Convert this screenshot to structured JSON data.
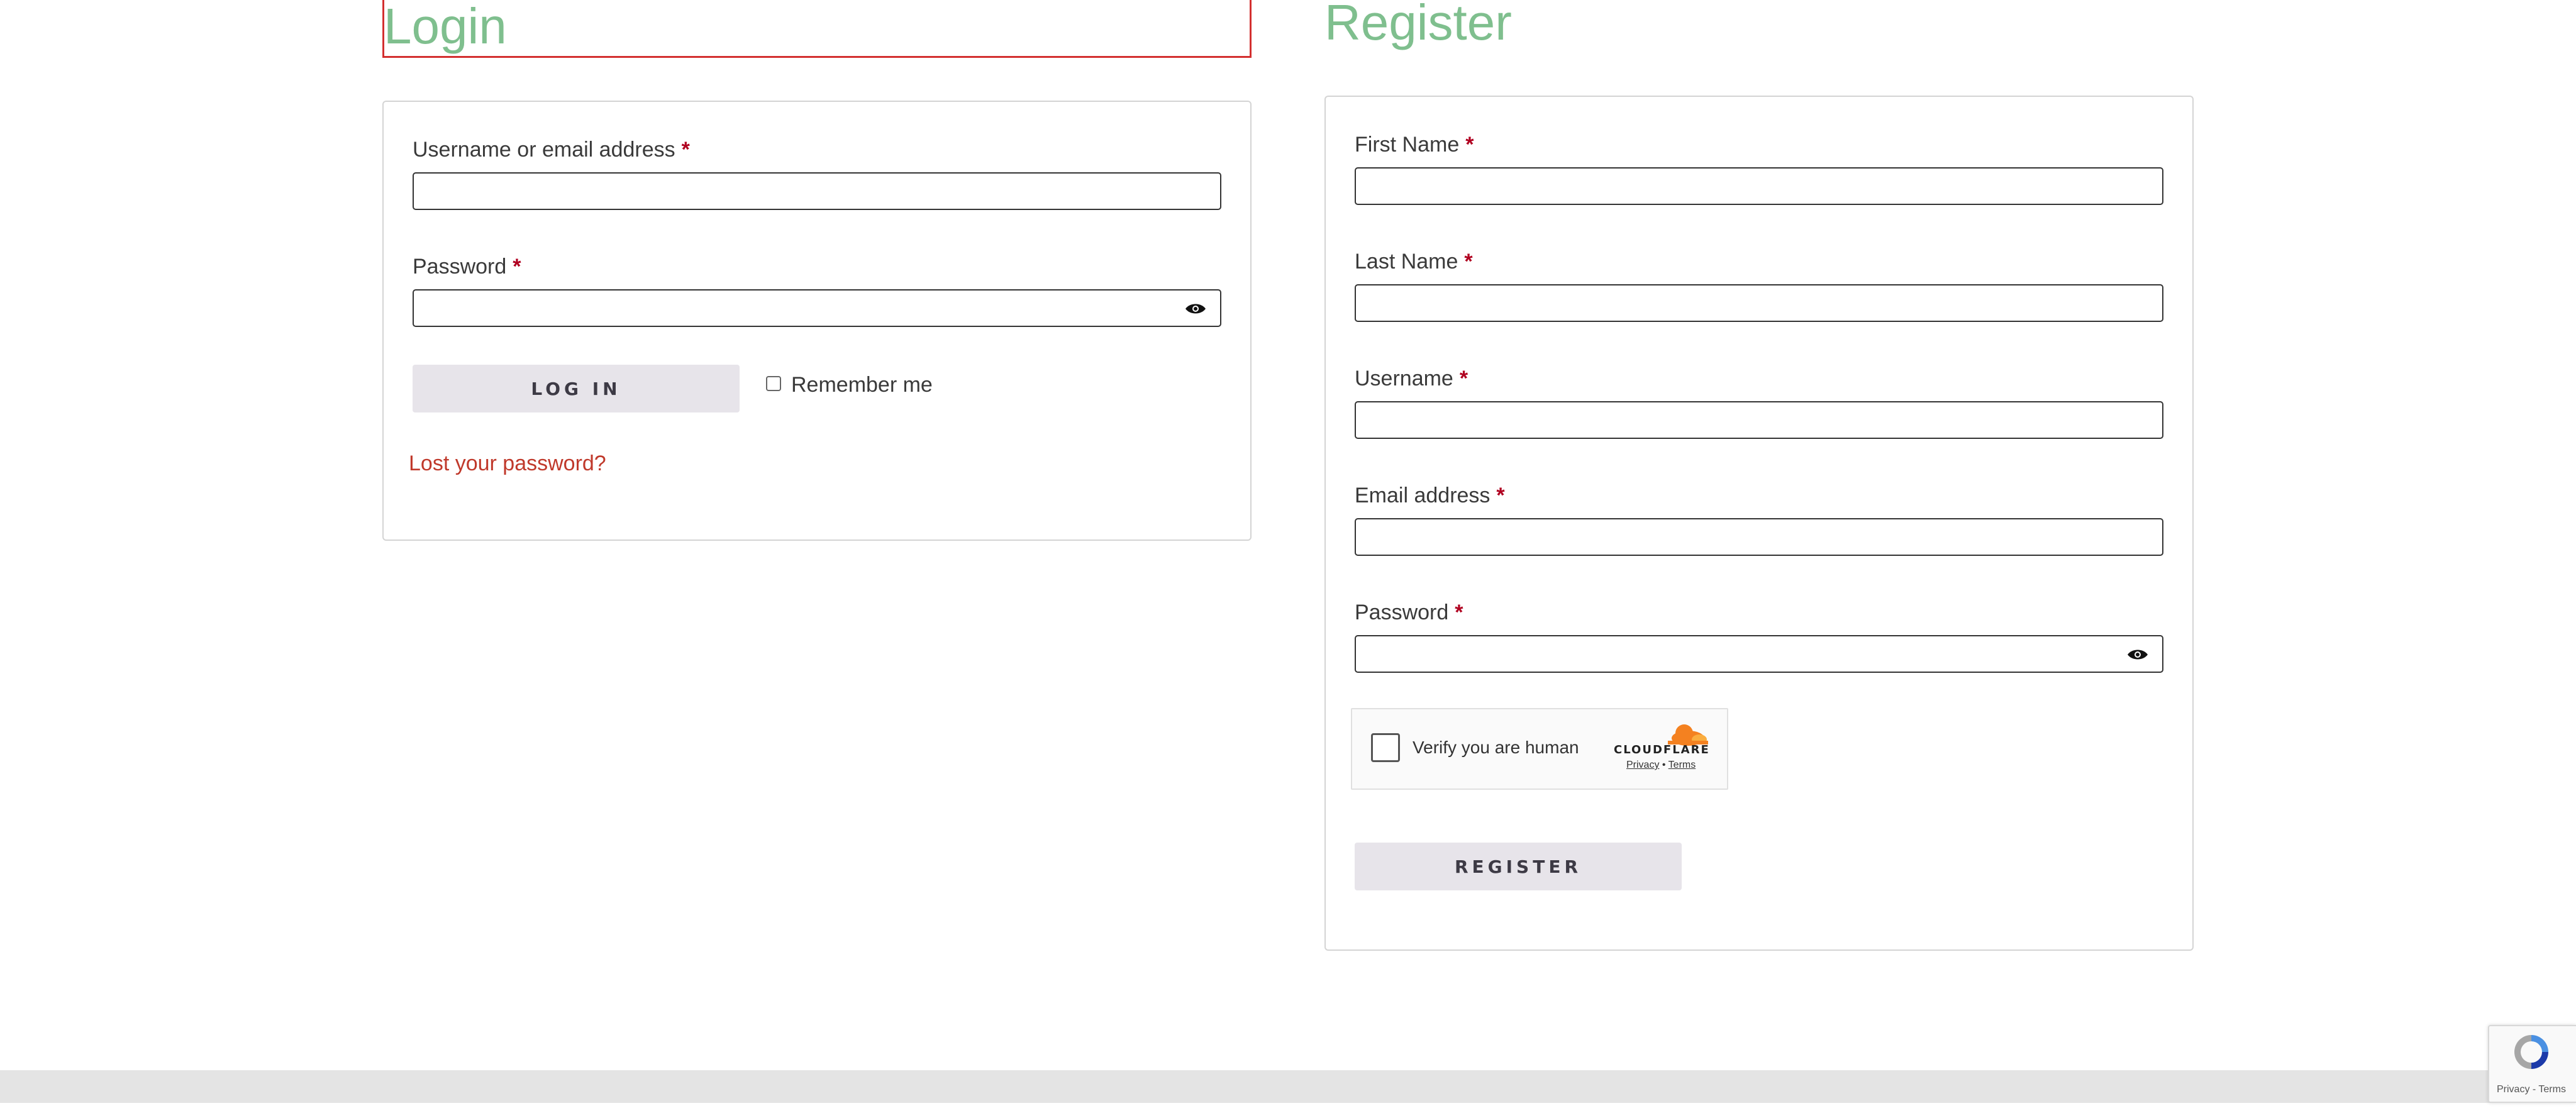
{
  "login": {
    "heading": "Login",
    "username_label": "Username or email address",
    "username_value": "",
    "password_label": "Password",
    "password_value": "",
    "required_mark": "*",
    "login_button": "LOG IN",
    "remember_label": "Remember me",
    "lost_password": "Lost your password?"
  },
  "register": {
    "heading": "Register",
    "first_name_label": "First Name",
    "last_name_label": "Last Name",
    "username_label": "Username",
    "email_label": "Email address",
    "password_label": "Password",
    "required_mark": "*",
    "register_button": "REGISTER"
  },
  "turnstile": {
    "text": "Verify you are human",
    "brand": "CLOUDFLARE",
    "privacy": "Privacy",
    "separator": "•",
    "terms": "Terms"
  },
  "recaptcha": {
    "links": "Privacy - Terms"
  },
  "colors": {
    "heading": "#7fbf8e",
    "required": "#b00020",
    "link": "#c0392b",
    "button_bg": "#e7e4ea",
    "cloudflare_orange": "#f48120"
  }
}
